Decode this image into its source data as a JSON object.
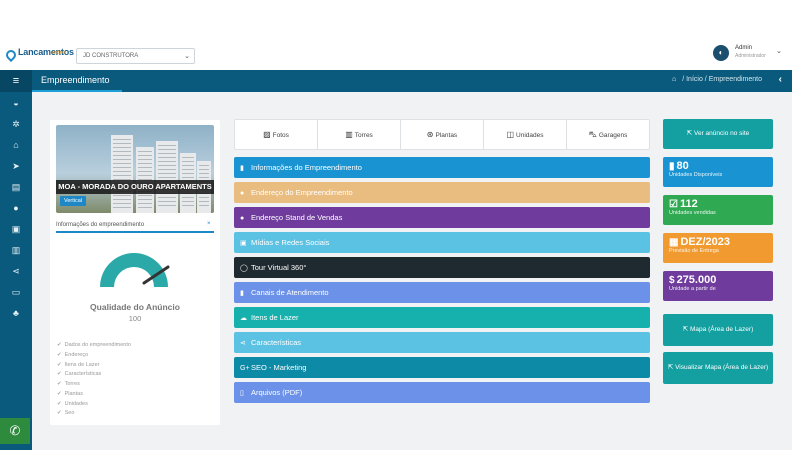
{
  "brand": {
    "logo_text": "Lancamentos",
    "logo_sub": "online"
  },
  "company_select": {
    "value": "JD CONSTRUTORA"
  },
  "user": {
    "name": "Admin",
    "role": "Administrador"
  },
  "header": {
    "title": "Empreendimento",
    "breadcrumb": [
      "Início",
      "Empreendimento"
    ]
  },
  "sidebar": {
    "icons": [
      "dashboard-icon",
      "cogs-icon",
      "bank-icon",
      "send-icon",
      "document-icon",
      "chat-icon",
      "briefcase-icon",
      "bar-chart-icon",
      "share-icon",
      "money-icon",
      "users-icon"
    ]
  },
  "property": {
    "banner": "MOA - MORADA DO OURO APARTAMENTS",
    "tag": "Vertical",
    "info_label": "Informações do empreendimento",
    "info_close": "×",
    "quality_title": "Qualidade do Anúncio",
    "quality_value": "100",
    "quality_fraction": 1.0,
    "checklist": [
      "Dados do empreendimento",
      "Endereço",
      "Itens de Lazer",
      "Características",
      "Torres",
      "Plantas",
      "Unidades",
      "Seo"
    ]
  },
  "tabs": [
    {
      "label": "Fotos",
      "icon": "image-icon"
    },
    {
      "label": "Torres",
      "icon": "building-icon"
    },
    {
      "label": "Plantas",
      "icon": "blueprint-icon"
    },
    {
      "label": "Unidades",
      "icon": "columns-icon"
    },
    {
      "label": "Garagens",
      "icon": "car-icon"
    }
  ],
  "sections": [
    {
      "label": "Informações do Empreendimento",
      "color": "#1a93d2",
      "glyph": "▮"
    },
    {
      "label": "Endereço do Empreendimento",
      "color": "#e9bc7f",
      "glyph": "●"
    },
    {
      "label": "Endereço Stand de Vendas",
      "color": "#6f3c9e",
      "glyph": "●"
    },
    {
      "label": "Mídias e Redes Sociais",
      "color": "#5cc2e3",
      "glyph": "▣"
    },
    {
      "label": "Tour Virtual 360°",
      "color": "#1f2a30",
      "glyph": "◯"
    },
    {
      "label": "Canais de Atendimento",
      "color": "#6b91e8",
      "glyph": "▮"
    },
    {
      "label": "Itens de Lazer",
      "color": "#17b1ad",
      "glyph": "☁"
    },
    {
      "label": "Características",
      "color": "#5cc2e3",
      "glyph": "⋖"
    },
    {
      "label": "SEO - Marketing",
      "color": "#0d8aa6",
      "glyph": "G+"
    },
    {
      "label": "Arquivos (PDF)",
      "color": "#6b91e8",
      "glyph": "▯"
    }
  ],
  "right": {
    "view_ad": "Ver anúncio no site",
    "stats": [
      {
        "value": "80",
        "label": "Unidades Disponíveis",
        "color": "#1a93d2",
        "glyph": "▮"
      },
      {
        "value": "112",
        "label": "Unidades vendidas",
        "color": "#2faa52",
        "glyph": "☑"
      },
      {
        "value": "DEZ/2023",
        "label": "Previsão de Entrega",
        "color": "#f19a2f",
        "glyph": "▦"
      },
      {
        "value": "275.000",
        "label": "Unidade a partir de",
        "color": "#6f3c9e",
        "glyph": "$"
      }
    ],
    "map_leisure": "Mapa (Área de Lazer)",
    "view_map": "Visualizar Mapa (Área de Lazer)"
  }
}
